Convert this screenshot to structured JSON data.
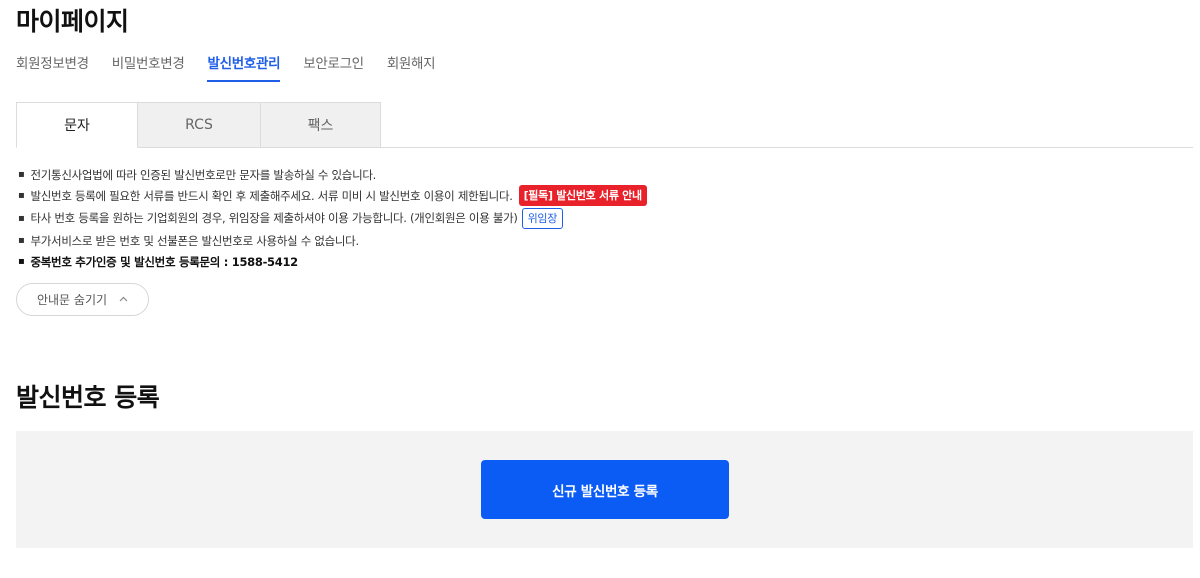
{
  "page": {
    "title": "마이페이지"
  },
  "subnav": {
    "items": [
      {
        "label": "회원정보변경",
        "active": false
      },
      {
        "label": "비밀번호변경",
        "active": false
      },
      {
        "label": "발신번호관리",
        "active": true
      },
      {
        "label": "보안로그인",
        "active": false
      },
      {
        "label": "회원해지",
        "active": false
      }
    ]
  },
  "tabs": [
    {
      "label": "문자",
      "active": true
    },
    {
      "label": "RCS",
      "active": false
    },
    {
      "label": "팩스",
      "active": false
    }
  ],
  "notices": {
    "items": [
      {
        "text": "전기통신사업법에 따라 인증된 발신번호로만 문자를 발송하실 수 있습니다."
      },
      {
        "text": "발신번호 등록에 필요한 서류를 반드시 확인 후 제출해주세요. 서류 미비 시 발신번호 이용이 제한됩니다.",
        "badge": "[필독] 발신번호 서류 안내"
      },
      {
        "text": "타사 번호 등록을 원하는 기업회원의 경우, 위임장을 제출하셔야 이용 가능합니다. (개인회원은 이용 불가)",
        "badge": "위임장"
      },
      {
        "text": "부가서비스로 받은 번호 및 선불폰은 발신번호로 사용하실 수 없습니다."
      },
      {
        "text": "중복번호 추가인증 및 발신번호 등록문의 : 1588-5412"
      }
    ],
    "bullet": "▪",
    "hide_label": "안내문 숨기기"
  },
  "register": {
    "section_title": "발신번호 등록",
    "button_label": "신규 발신번호 등록"
  },
  "colors": {
    "accent": "#1f5fe8",
    "button": "#0b5cf5",
    "badge_red": "#e8212a"
  }
}
